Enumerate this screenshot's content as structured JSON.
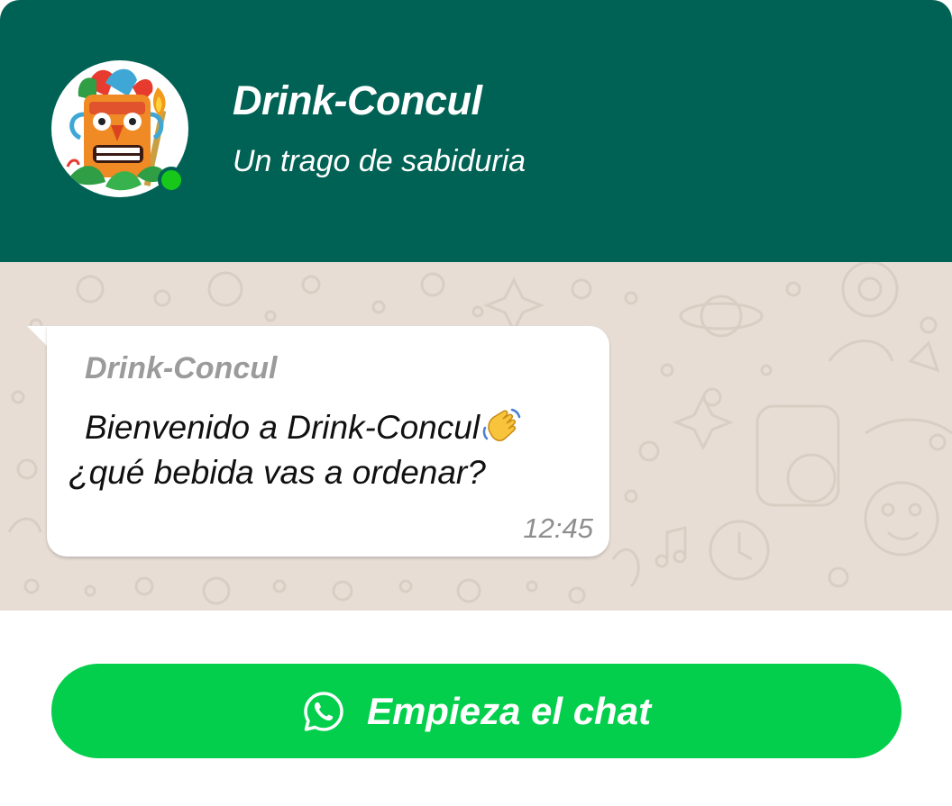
{
  "header": {
    "title": "Drink-Concul",
    "subtitle": "Un trago de sabiduria",
    "avatar_icon": "tiki-mask-icon",
    "online_status_color": "#17c81a"
  },
  "message": {
    "author": "Drink-Concul",
    "line1": "Bienvenido a Drink-Concul",
    "line1_emoji": "waving-hand-icon",
    "line2": "¿qué bebida vas a ordenar?",
    "time": "12:45"
  },
  "cta": {
    "label": "Empieza el chat",
    "icon": "whatsapp-icon"
  },
  "colors": {
    "header_bg": "#006254",
    "chat_bg": "#e7ddd4",
    "button_bg": "#04cf4d",
    "bubble_bg": "#ffffff"
  }
}
